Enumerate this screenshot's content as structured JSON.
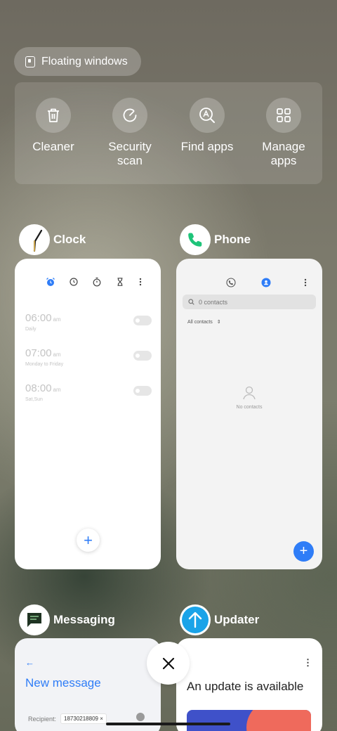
{
  "floating_windows": {
    "label": "Floating windows"
  },
  "quick_actions": [
    {
      "label": "Cleaner",
      "icon": "trash-icon"
    },
    {
      "label": "Security\nscan",
      "icon": "security-scan-icon"
    },
    {
      "label": "Find apps",
      "icon": "find-apps-icon"
    },
    {
      "label": "Manage\napps",
      "icon": "grid-icon"
    }
  ],
  "apps": {
    "clock": {
      "name": "Clock",
      "alarms": [
        {
          "time": "06:00",
          "ampm": "am",
          "repeat": "Daily"
        },
        {
          "time": "07:00",
          "ampm": "am",
          "repeat": "Monday to Friday"
        },
        {
          "time": "08:00",
          "ampm": "am",
          "repeat": "Sat,Sun"
        }
      ],
      "fab": "+"
    },
    "phone": {
      "name": "Phone",
      "search_placeholder": "0 contacts",
      "filter": "All contacts",
      "empty": "No contacts",
      "fab": "+"
    },
    "messaging": {
      "name": "Messaging",
      "back": "←",
      "title": "New message",
      "recipient_label": "Recipient:",
      "recipient_number": "18730218809",
      "chip_remove": "×"
    },
    "updater": {
      "name": "Updater",
      "title": "An update is available",
      "more": "⋮"
    }
  },
  "colors": {
    "accent_blue": "#2f7df7",
    "phone_green": "#1fc47a",
    "updater_blue": "#1aa3e8"
  }
}
